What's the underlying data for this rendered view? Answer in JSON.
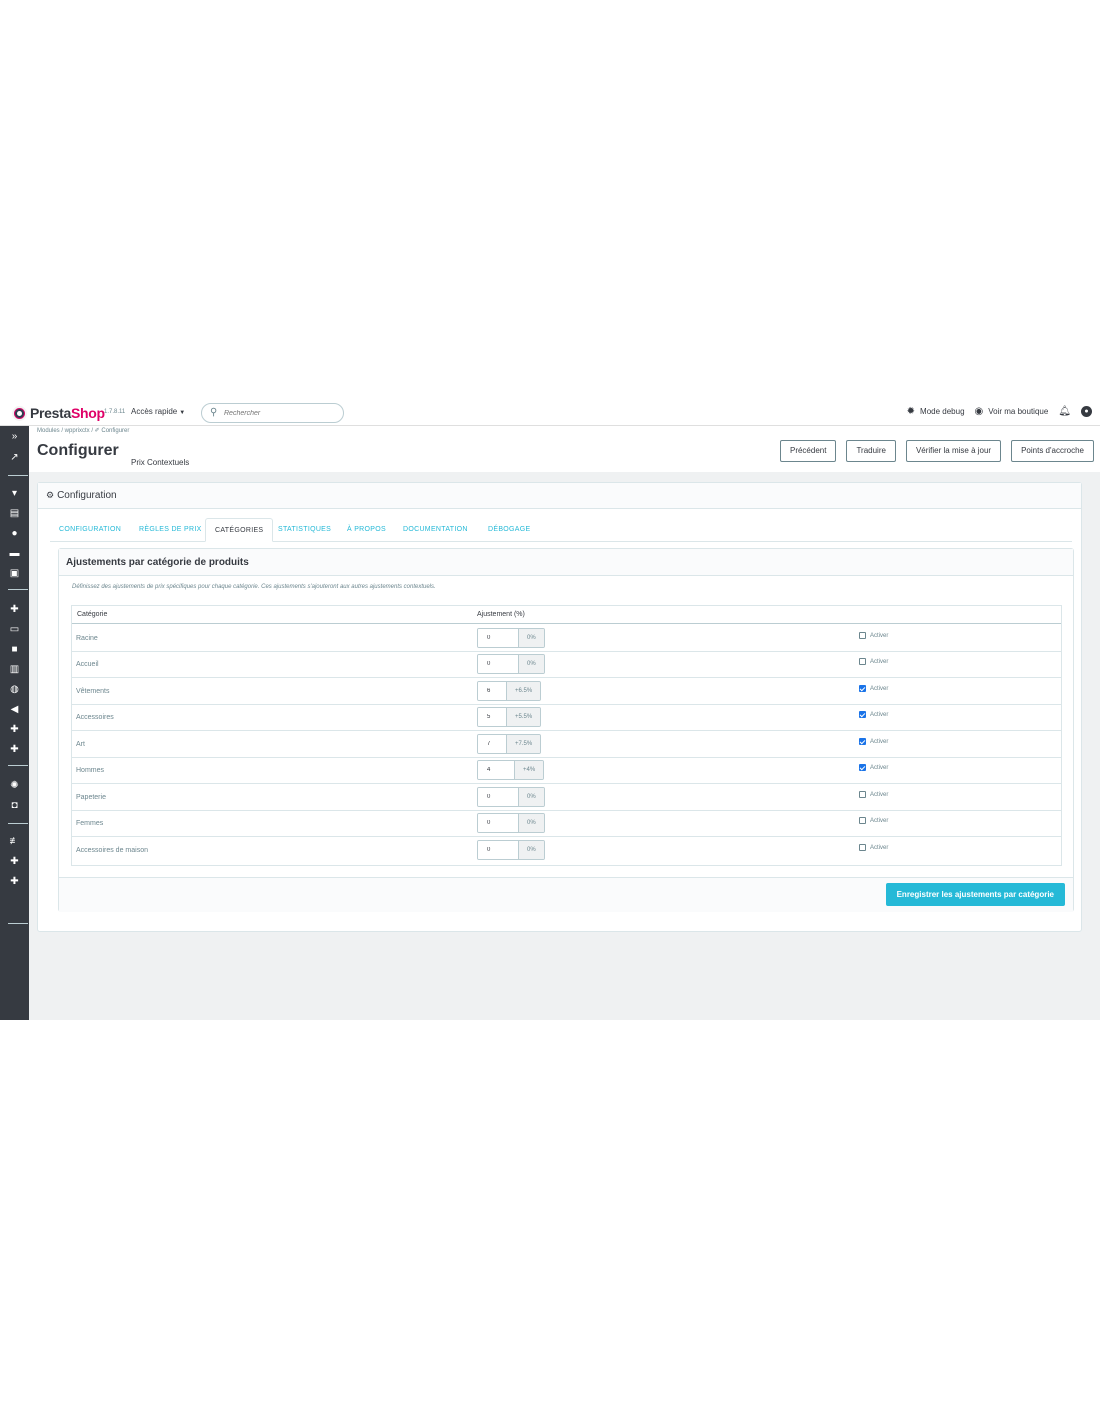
{
  "header": {
    "brand_part1": "Presta",
    "brand_part2": "Shop",
    "version": "1.7.8.11",
    "quick_access": "Accès rapide",
    "search_placeholder": "Rechercher",
    "debug_mode": "Mode debug",
    "view_shop": "Voir ma boutique"
  },
  "breadcrumb": "Modules / wpprixctx / ✐ Configurer",
  "page": {
    "title": "Configurer",
    "subtitle": "Prix Contextuels"
  },
  "toolbar": {
    "previous": "Précédent",
    "translate": "Traduire",
    "check_update": "Vérifier la mise à jour",
    "hooks": "Points d'accroche"
  },
  "panel": {
    "title": "Configuration"
  },
  "tabs": [
    {
      "label": "CONFIGURATION",
      "active": false
    },
    {
      "label": "RÈGLES DE PRIX",
      "active": false
    },
    {
      "label": "CATÉGORIES",
      "active": true
    },
    {
      "label": "STATISTIQUES",
      "active": false
    },
    {
      "label": "À PROPOS",
      "active": false
    },
    {
      "label": "DOCUMENTATION",
      "active": false
    },
    {
      "label": "DÉBOGAGE",
      "active": false
    }
  ],
  "card": {
    "title": "Ajustements par catégorie de produits",
    "description": "Définissez des ajustements de prix spécifiques pour chaque catégorie. Ces ajustements s'ajouteront aux autres ajustements contextuels.",
    "col_category": "Catégorie",
    "col_adjustment": "Ajustement (%)",
    "activate_label": "Activer",
    "save_label": "Enregistrer les ajustements par catégorie"
  },
  "rows": [
    {
      "name": "Racine",
      "value": "0",
      "addon": "0%",
      "enabled": false
    },
    {
      "name": "Accueil",
      "value": "0",
      "addon": "0%",
      "enabled": false
    },
    {
      "name": "Vêtements",
      "value": "6",
      "addon": "+6.5%",
      "enabled": true
    },
    {
      "name": "Accessoires",
      "value": "5",
      "addon": "+5.5%",
      "enabled": true
    },
    {
      "name": "Art",
      "value": "7",
      "addon": "+7.5%",
      "enabled": true
    },
    {
      "name": "Hommes",
      "value": "4",
      "addon": "+4%",
      "enabled": true
    },
    {
      "name": "Papeterie",
      "value": "0",
      "addon": "0%",
      "enabled": false
    },
    {
      "name": "Femmes",
      "value": "0",
      "addon": "0%",
      "enabled": false
    },
    {
      "name": "Accessoires de maison",
      "value": "0",
      "addon": "0%",
      "enabled": false
    }
  ],
  "colors": {
    "accent": "#25b9d7",
    "sidebar": "#363a41",
    "brand_pink": "#df0067"
  }
}
